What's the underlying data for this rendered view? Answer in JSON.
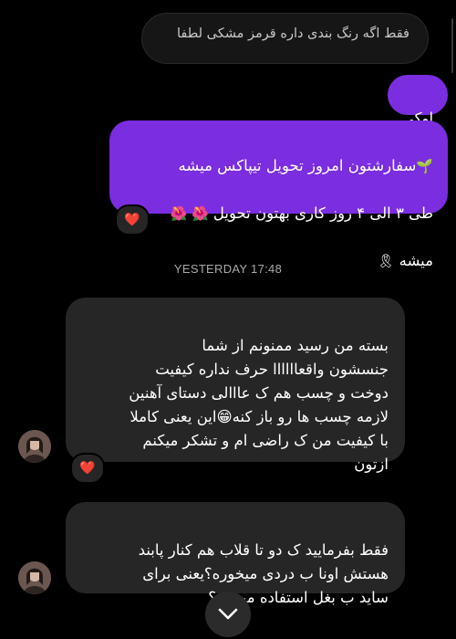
{
  "thread": {
    "quoted_reply": "فقط اگه رنگ بندی داره قرمز مشکی لطفا",
    "timestamp": "YESTERDAY 17:48"
  },
  "messages": [
    {
      "id": "out-oki",
      "direction": "outgoing",
      "text": "اوکی"
    },
    {
      "id": "out-order",
      "direction": "outgoing",
      "text_line1": "سفارشتون امروز تحویل تیپاکس میشه",
      "text_line2": "طی ۳ الی ۴ روز کاری بهتون تحویل",
      "text_line3": "میشه",
      "emoji_sprout": "🌱",
      "emoji_flowers": "🌺 🌺",
      "emoji_ribbon": "🎗",
      "reaction": "❤️"
    },
    {
      "id": "in-thanks",
      "direction": "incoming",
      "text": "بسته من رسید ممنونم از شما\nجنسشون واقعاااااا حرف نداره کیفیت\nدوخت و چسب هم ک عااالی دستای آهنین\nلازمه چسب ها رو باز کنه😁این یعنی کاملا\nبا کیفیت من ک راضی ام و تشکر میکنم\nازتون",
      "reaction": "❤️"
    },
    {
      "id": "in-question",
      "direction": "incoming",
      "text": "فقط بفرمایید ک دو تا قلاب هم کنار  پابند\nهستش اونا ب دردی میخوره؟یعنی برای\nساید ب بغل استفاده میشه ؟"
    }
  ],
  "colors": {
    "background": "#000000",
    "incoming_bubble": "#262626",
    "outgoing_bubble": "#7b2de0",
    "timestamp": "#a8a8a8"
  },
  "icons": {
    "scroll_down": "chevron-down-icon",
    "avatar": "user-avatar"
  }
}
